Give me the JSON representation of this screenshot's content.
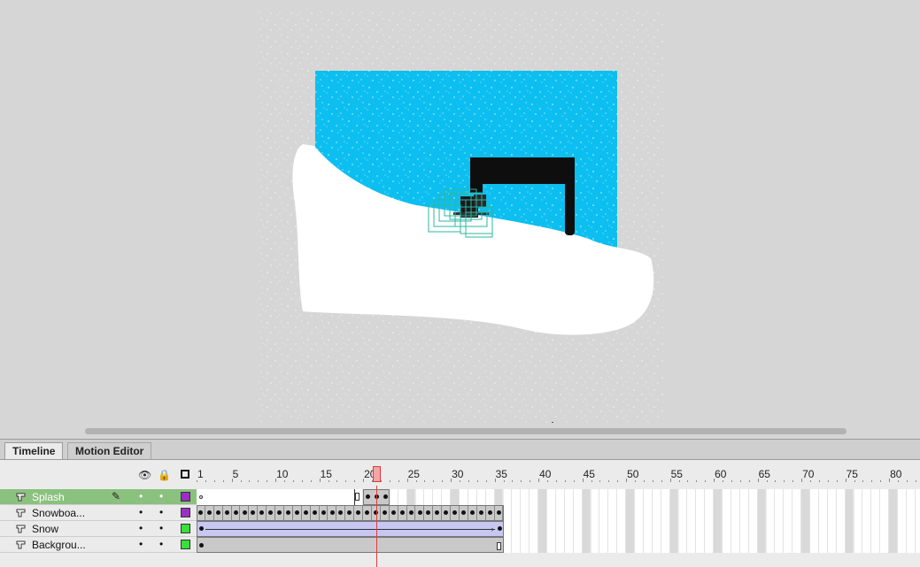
{
  "tabs": [
    {
      "label": "Timeline"
    },
    {
      "label": "Motion Editor"
    }
  ],
  "ruler": {
    "labels": [
      "1",
      "5",
      "10",
      "15",
      "20",
      "25",
      "30",
      "35",
      "40",
      "45",
      "50",
      "55",
      "60",
      "65",
      "70",
      "75",
      "80"
    ]
  },
  "layers": [
    {
      "name": "Splash",
      "selected": true,
      "color": "#9b2fc3",
      "pencil": true,
      "frames_until": 22
    },
    {
      "name": "Snowboa...",
      "selected": false,
      "color": "#9b2fc3",
      "frames_until": 35
    },
    {
      "name": "Snow",
      "selected": false,
      "color": "#38e03a",
      "frames_until": 35
    },
    {
      "name": "Backgrou...",
      "selected": false,
      "color": "#38e03a",
      "frames_until": 35
    }
  ],
  "current_frame": 21,
  "colors": {
    "sky": "#0cbff0",
    "stage_bg": "#d6d6d6",
    "selected_layer": "#8bc17e",
    "tween": "#c7c7f2",
    "playhead": "#e23b3b"
  }
}
